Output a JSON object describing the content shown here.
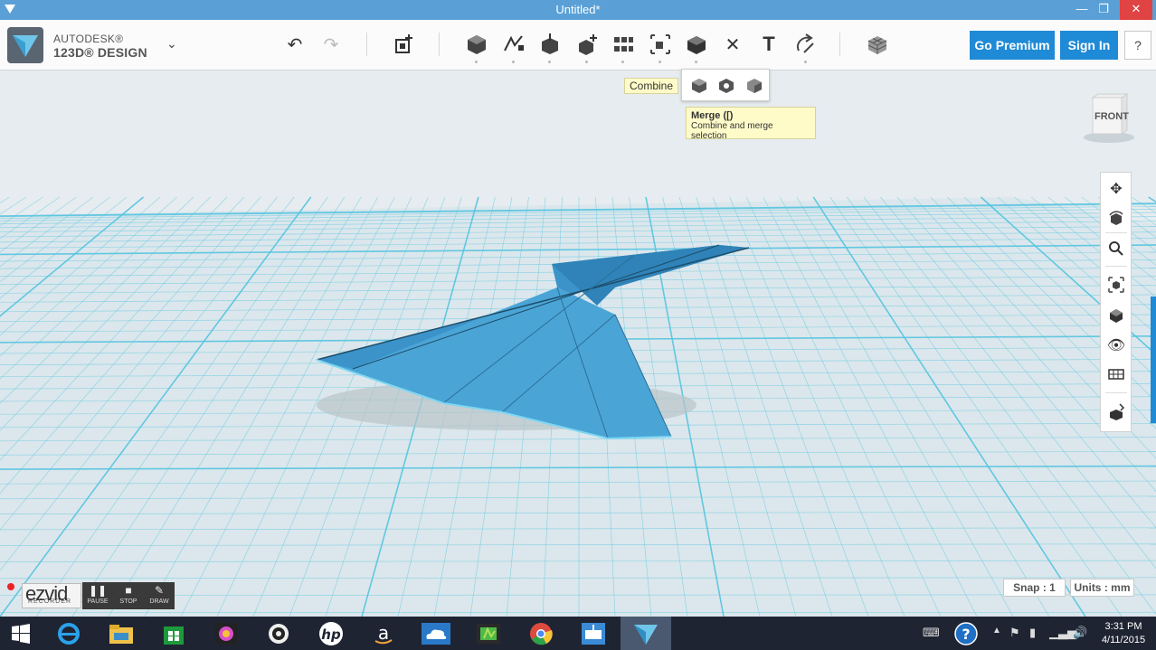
{
  "window": {
    "title": "Untitled*",
    "minimize": "—",
    "maximize": "❐",
    "close": "✕"
  },
  "brand": {
    "line1": "AUTODESK®",
    "line2": "123D® DESIGN",
    "chevron": "⌄"
  },
  "toolbar": {
    "undo": "↶",
    "redo": "↷",
    "text_tool": "T",
    "delete_tool": "✕",
    "premium_label": "Go Premium",
    "signin_label": "Sign In",
    "help_label": "?"
  },
  "combine": {
    "label": "Combine",
    "tooltip_title": "Merge ([)",
    "tooltip_desc": "Combine and merge selection"
  },
  "viewcube": {
    "face_label": "FRONT"
  },
  "status": {
    "snap": "Snap : 1",
    "units": "Units : mm"
  },
  "ezvid": {
    "logo": "ezvid",
    "sub": "RECORDER",
    "pause": "PAUSE",
    "stop": "STOP",
    "draw": "DRAW"
  },
  "taskbar": {
    "time": "3:31 PM",
    "date": "4/11/2015"
  },
  "colors": {
    "accent": "#1f8ad6",
    "grid": "#55c4e0",
    "model": "#3b93c9",
    "taskbar": "#1f2433"
  }
}
